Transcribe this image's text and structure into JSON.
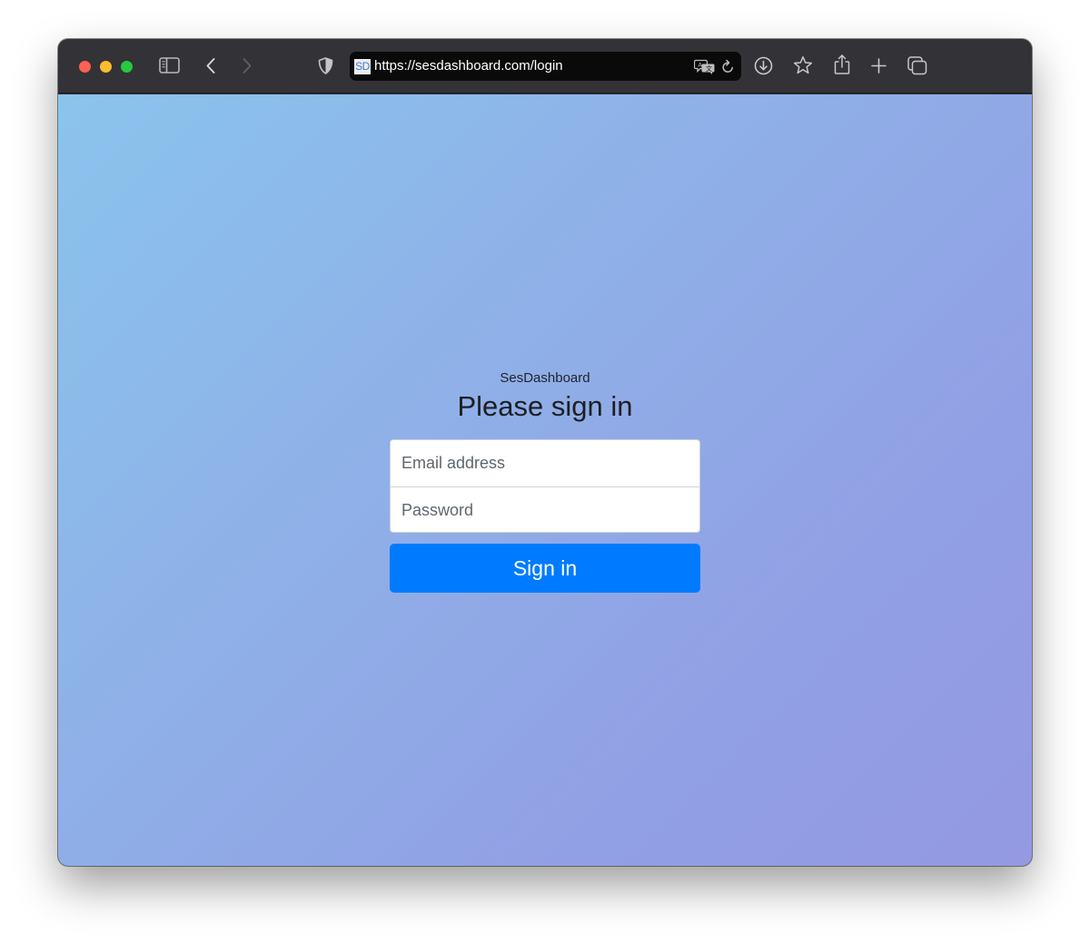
{
  "browser": {
    "url": "https://sesdashboard.com/login",
    "favicon_text": "SD",
    "toolbar_icons": {
      "sidebar": "sidebar-icon",
      "back": "chevron-left-icon",
      "forward": "chevron-right-icon",
      "privacy": "shield-icon",
      "translate": "translate-icon",
      "reload": "reload-icon",
      "downloads": "download-icon",
      "bookmark": "star-icon",
      "share": "share-icon",
      "new_tab": "plus-icon",
      "tab_overview": "tabs-icon"
    }
  },
  "page": {
    "brand": "SesDashboard",
    "heading": "Please sign in",
    "email": {
      "placeholder": "Email address",
      "value": ""
    },
    "password": {
      "placeholder": "Password",
      "value": ""
    },
    "submit_label": "Sign in"
  },
  "colors": {
    "primary": "#007bff",
    "background_start": "#8ac4ec",
    "background_end": "#9499e2"
  }
}
